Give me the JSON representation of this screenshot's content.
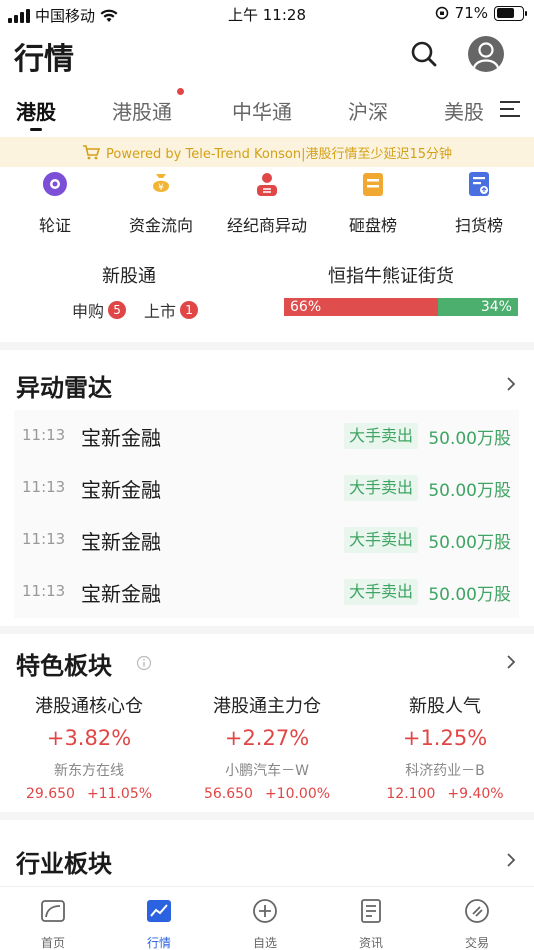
{
  "status_bar": {
    "carrier": "中国移动",
    "time": "上午 11:28",
    "battery": "71%",
    "battery_level": 0.71
  },
  "header": {
    "title": "行情"
  },
  "tabs": [
    {
      "label": "港股",
      "active": true
    },
    {
      "label": "港股通",
      "has_dot": true
    },
    {
      "label": "中华通"
    },
    {
      "label": "沪深"
    },
    {
      "label": "美股"
    }
  ],
  "notice": {
    "text": "Powered by Tele-Trend Konson|港股行情至少延迟15分钟"
  },
  "quick_entries": [
    {
      "label": "轮证",
      "icon": "warrant-icon",
      "color": "#7b4fd8"
    },
    {
      "label": "资金流向",
      "icon": "money-bag-icon",
      "color": "#f2b533"
    },
    {
      "label": "经纪商异动",
      "icon": "broker-icon",
      "color": "#e04848"
    },
    {
      "label": "砸盘榜",
      "icon": "dump-board-icon",
      "color": "#f0a830"
    },
    {
      "label": "扫货榜",
      "icon": "sweep-board-icon",
      "color": "#4a6fe0"
    }
  ],
  "new_stock": {
    "title": "新股通",
    "subscribe_label": "申购",
    "subscribe_count": "5",
    "listing_label": "上市",
    "listing_count": "1"
  },
  "bull_bear": {
    "title": "恒指牛熊证街货",
    "bull_pct": "66%",
    "bear_pct": "34%",
    "bull_fraction": 0.66
  },
  "radar": {
    "title": "异动雷达",
    "rows": [
      {
        "time": "11:13",
        "name": "宝新金融",
        "tag": "大手卖出",
        "volume": "50.00万股"
      },
      {
        "time": "11:13",
        "name": "宝新金融",
        "tag": "大手卖出",
        "volume": "50.00万股"
      },
      {
        "time": "11:13",
        "name": "宝新金融",
        "tag": "大手卖出",
        "volume": "50.00万股"
      },
      {
        "time": "11:13",
        "name": "宝新金融",
        "tag": "大手卖出",
        "volume": "50.00万股"
      }
    ]
  },
  "featured": {
    "title": "特色板块",
    "sectors": [
      {
        "name": "港股通核心仓",
        "pct": "+3.82%",
        "stock": "新东方在线",
        "price": "29.650",
        "change": "+11.05%"
      },
      {
        "name": "港股通主力仓",
        "pct": "+2.27%",
        "stock": "小鹏汽车－W",
        "price": "56.650",
        "change": "+10.00%"
      },
      {
        "name": "新股人气",
        "pct": "+1.25%",
        "stock": "科济药业－B",
        "price": "12.100",
        "change": "+9.40%"
      }
    ]
  },
  "industry": {
    "title": "行业板块"
  },
  "bottom_nav": [
    {
      "label": "首页",
      "icon": "home-icon"
    },
    {
      "label": "行情",
      "icon": "market-chart-icon",
      "active": true
    },
    {
      "label": "自选",
      "icon": "add-watchlist-icon"
    },
    {
      "label": "资讯",
      "icon": "news-icon"
    },
    {
      "label": "交易",
      "icon": "trade-icon"
    }
  ],
  "colors": {
    "up": "#e04646",
    "down": "#3fa463",
    "accent": "#2b62e0",
    "notice_text": "#d4a017"
  }
}
